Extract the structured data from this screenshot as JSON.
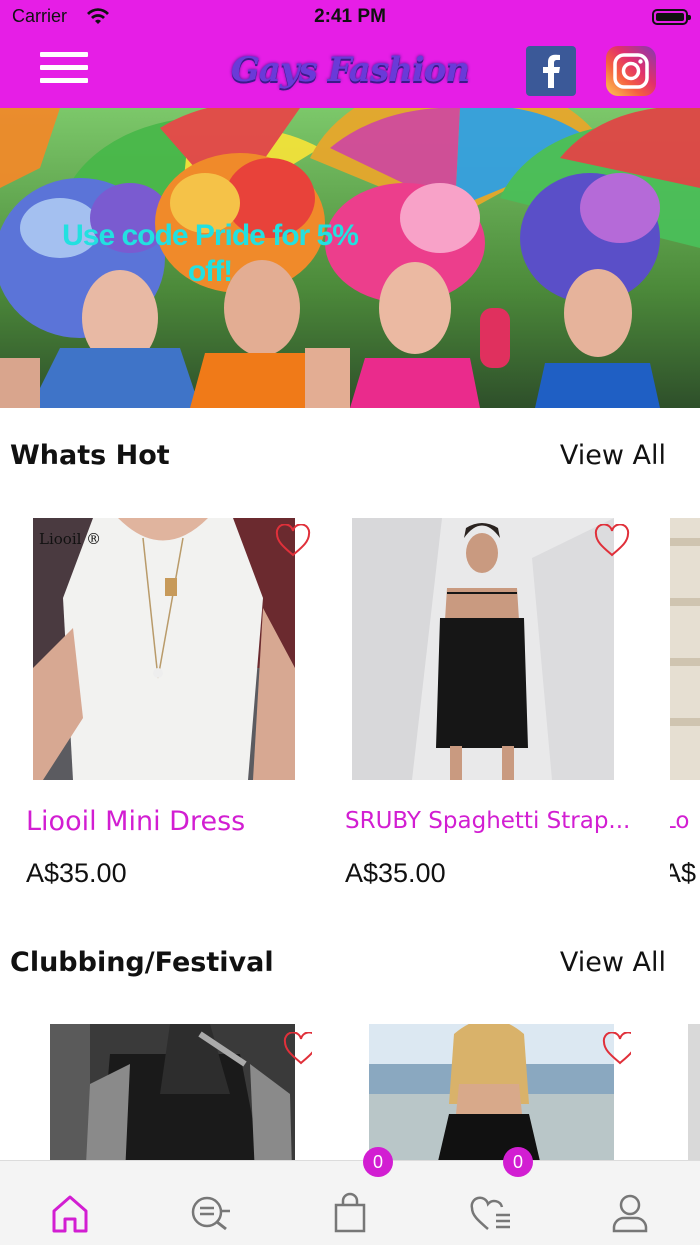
{
  "status_bar": {
    "carrier": "Carrier",
    "time": "2:41 PM"
  },
  "header": {
    "title": "Gays Fashion",
    "menu_icon": "hamburger-menu-icon",
    "social": [
      {
        "name": "facebook",
        "icon": "facebook-icon",
        "label": "f"
      },
      {
        "name": "instagram",
        "icon": "instagram-icon"
      }
    ]
  },
  "banner": {
    "promo_text": "Use code Pride for 5% off!"
  },
  "sections": [
    {
      "title": "Whats Hot",
      "view_all": "View All",
      "products": [
        {
          "name": "Liooil Mini Dress",
          "price": "A$35.00",
          "brand_mark": "Liooil ®"
        },
        {
          "name": "SRUBY Spaghetti Strap...",
          "price": "A$35.00"
        },
        {
          "name": "Lo",
          "price": "A$"
        }
      ]
    },
    {
      "title": "Clubbing/Festival",
      "view_all": "View All"
    }
  ],
  "tab_bar": {
    "items": [
      {
        "name": "home",
        "icon": "home-icon",
        "active": true
      },
      {
        "name": "search",
        "icon": "search-list-icon"
      },
      {
        "name": "cart",
        "icon": "shopping-bag-icon",
        "badge": "0"
      },
      {
        "name": "wishlist",
        "icon": "heart-list-icon",
        "badge": "0"
      },
      {
        "name": "profile",
        "icon": "user-icon"
      }
    ]
  },
  "colors": {
    "brand": "#e61ee6",
    "accent_text": "#d21ed2",
    "heart": "#e0303a",
    "promo": "#22e0e0"
  }
}
